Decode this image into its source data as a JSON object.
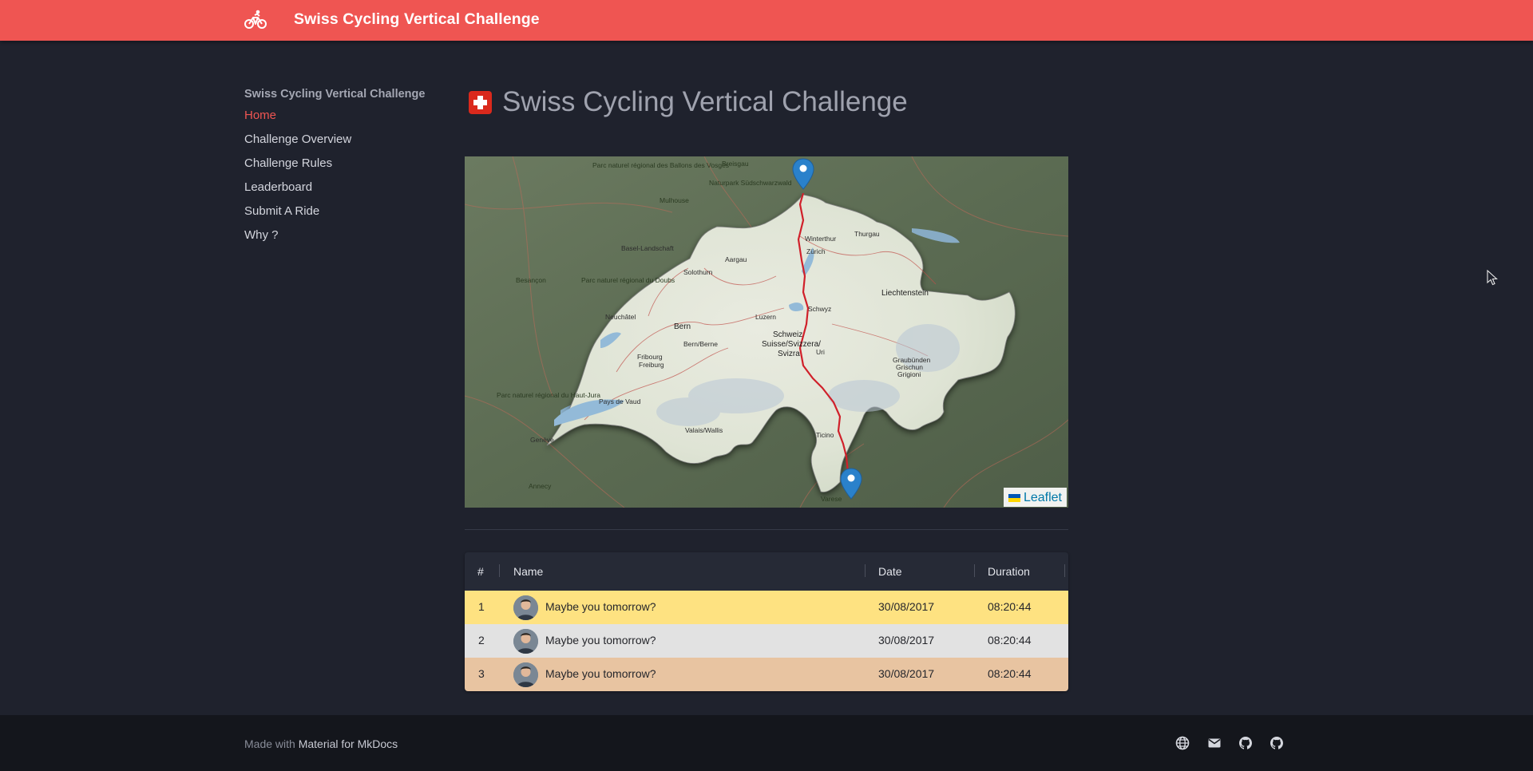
{
  "header": {
    "logo_icon": "bicycle-icon",
    "title": "Swiss Cycling Vertical Challenge"
  },
  "sidebar": {
    "title": "Swiss Cycling Vertical Challenge",
    "items": [
      {
        "label": "Home",
        "active": true
      },
      {
        "label": "Challenge Overview",
        "active": false
      },
      {
        "label": "Challenge Rules",
        "active": false
      },
      {
        "label": "Leaderboard",
        "active": false
      },
      {
        "label": "Submit A Ride",
        "active": false
      },
      {
        "label": "Why ?",
        "active": false
      }
    ]
  },
  "main": {
    "title_icon": "swiss-flag-icon",
    "title": "Swiss Cycling Vertical Challenge"
  },
  "map": {
    "attribution": "Leaflet",
    "labels": {
      "bern": "Bern",
      "schweiz": "Schweiz",
      "suisse": "Suisse/Svizzera/",
      "svizra": "Svizra",
      "liechtenstein": "Liechtenstein",
      "besancon": "Besançon",
      "mulhouse": "Mulhouse",
      "winterthur": "Winterthur",
      "zurich": "Zürich",
      "luzern": "Luzern",
      "schwyz": "Schwyz",
      "solothurn": "Solothurn",
      "neuchatel": "Neuchâtel",
      "fribourg": "Fribourg",
      "freiburg": "Freiburg",
      "bernberne": "Bern/Berne",
      "graubunden": "Graubünden",
      "grischun": "Grischun",
      "grigioni": "Grigioni",
      "thurgau": "Thurgau",
      "valais": "Valais/Wallis",
      "geneve": "Genève",
      "annecy": "Annecy",
      "varese": "Varese",
      "basel": "Basel-Landschaft",
      "aargau": "Aargau",
      "uri": "Uri",
      "ticino": "Ticino",
      "vaud": "Pays de Vaud",
      "naturpark": "Naturpark Südschwarzwald",
      "ballons": "Parc naturel régional des Ballons des Vosges",
      "doubs": "Parc naturel régional du Doubs",
      "jura": "Parc naturel régional du Haut-Jura",
      "breisgau": "Breisgau"
    },
    "markers": [
      "start-marker",
      "end-marker"
    ],
    "route_color": "#d0202a"
  },
  "table": {
    "columns": [
      "#",
      "Name",
      "Date",
      "Duration"
    ],
    "rows": [
      {
        "rank": "1",
        "name": "Maybe you tomorrow?",
        "date": "30/08/2017",
        "duration": "08:20:44",
        "color": "#fee281"
      },
      {
        "rank": "2",
        "name": "Maybe you tomorrow?",
        "date": "30/08/2017",
        "duration": "08:20:44",
        "color": "#e2e2e2"
      },
      {
        "rank": "3",
        "name": "Maybe you tomorrow?",
        "date": "30/08/2017",
        "duration": "08:20:44",
        "color": "#e8c4a1"
      }
    ]
  },
  "footer": {
    "made_prefix": "Made with",
    "made_link": "Material for MkDocs",
    "social_icons": [
      "globe-icon",
      "mail-icon",
      "github-icon",
      "github-icon"
    ]
  },
  "colors": {
    "accent": "#ef5552",
    "background": "#1f222d",
    "footer": "#14161c"
  }
}
